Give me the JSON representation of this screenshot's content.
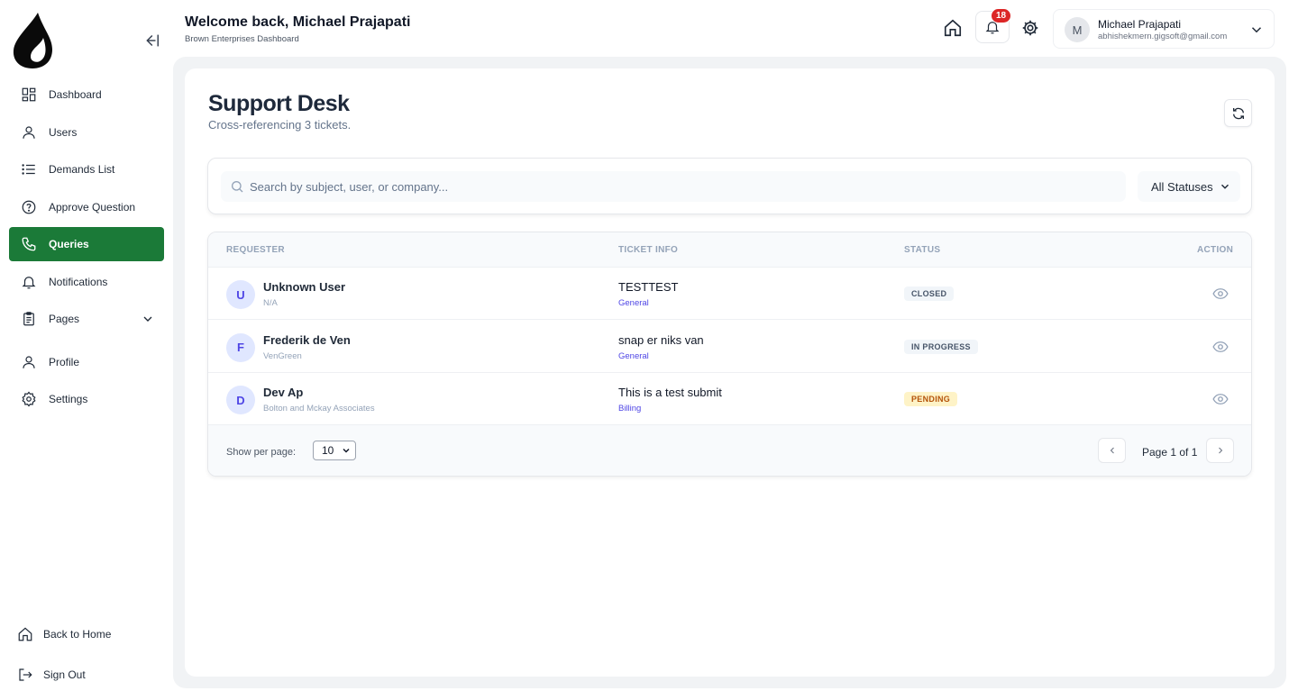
{
  "sidebar": {
    "items": [
      {
        "label": "Dashboard",
        "icon": "dashboard-icon"
      },
      {
        "label": "Users",
        "icon": "user-icon"
      },
      {
        "label": "Demands List",
        "icon": "list-icon"
      },
      {
        "label": "Approve Question",
        "icon": "question-icon"
      },
      {
        "label": "Queries",
        "icon": "phone-icon",
        "active": true
      },
      {
        "label": "Notifications",
        "icon": "bell-icon"
      },
      {
        "label": "Pages",
        "icon": "clipboard-icon",
        "has_submenu": true
      },
      {
        "label": "Profile",
        "icon": "user-icon"
      },
      {
        "label": "Settings",
        "icon": "gear-icon"
      }
    ],
    "bottom": {
      "back_home": "Back to Home",
      "sign_out": "Sign Out"
    },
    "accent_color": "#1b7a38"
  },
  "header": {
    "welcome": "Welcome back, Michael Prajapati",
    "company": "Brown Enterprises Dashboard",
    "notification_count": "18",
    "user": {
      "initial": "M",
      "name": "Michael Prajapati",
      "email": "abhishekmern.gigsoft@gmail.com"
    }
  },
  "page": {
    "title": "Support Desk",
    "subtitle": "Cross-referencing 3 tickets."
  },
  "filters": {
    "search_placeholder": "Search by subject, user, or company...",
    "status_selected": "All Statuses"
  },
  "table": {
    "columns": [
      "REQUESTER",
      "TICKET INFO",
      "STATUS",
      "ACTION"
    ],
    "rows": [
      {
        "initial": "U",
        "name": "Unknown User",
        "company": "N/A",
        "subject": "TESTTEST",
        "category": "General",
        "status": "CLOSED"
      },
      {
        "initial": "F",
        "name": "Frederik de Ven",
        "company": "VenGreen",
        "subject": "snap er niks van",
        "category": "General",
        "status": "IN PROGRESS"
      },
      {
        "initial": "D",
        "name": "Dev Ap",
        "company": "Bolton and Mckay Associates",
        "subject": "This is a test submit",
        "category": "Billing",
        "status": "PENDING"
      }
    ],
    "footer": {
      "per_page_label": "Show per page:",
      "per_page_value": "10",
      "page_text": "Page 1 of 1"
    }
  }
}
